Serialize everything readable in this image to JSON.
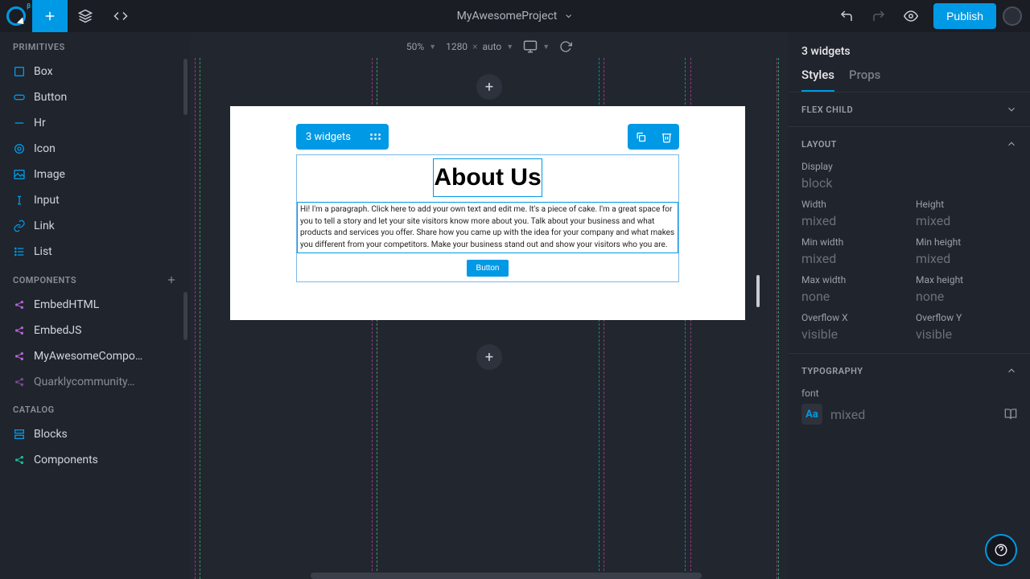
{
  "project": {
    "name": "MyAwesomeProject"
  },
  "topbar": {
    "publish": "Publish",
    "beta": "β"
  },
  "canvasToolbar": {
    "zoom": "50%",
    "width": "1280",
    "height": "auto",
    "sep": "×"
  },
  "selection": {
    "label": "3 widgets"
  },
  "artboard": {
    "heading": "About Us",
    "paragraph": "Hi! I'm a paragraph. Click here to add your own text and edit me. It's a piece of cake. I'm a great space for you to tell a story and let your site visitors know more about you. Talk about your business and what products and services you offer. Share how you came up with the idea for your company and what makes you different from your competitors. Make your business stand out and show your visitors who you are.",
    "button": "Button"
  },
  "left": {
    "sections": {
      "primitives": "PRIMITIVES",
      "components": "COMPONENTS",
      "catalog": "CATALOG"
    },
    "primitives": [
      "Box",
      "Button",
      "Hr",
      "Icon",
      "Image",
      "Input",
      "Link",
      "List"
    ],
    "components": [
      "EmbedHTML",
      "EmbedJS",
      "MyAwesomeCompo…",
      "Quarklycommunity…"
    ],
    "catalog": [
      "Blocks",
      "Components"
    ]
  },
  "right": {
    "title": "3 widgets",
    "tabs": {
      "styles": "Styles",
      "props": "Props"
    },
    "flexChild": "FLEX CHILD",
    "layout": {
      "title": "LAYOUT",
      "display": {
        "label": "Display",
        "value": "block"
      },
      "width": {
        "label": "Width",
        "value": "mixed"
      },
      "height": {
        "label": "Height",
        "value": "mixed"
      },
      "minWidth": {
        "label": "Min width",
        "value": "mixed"
      },
      "minHeight": {
        "label": "Min height",
        "value": "mixed"
      },
      "maxWidth": {
        "label": "Max width",
        "value": "none"
      },
      "maxHeight": {
        "label": "Max height",
        "value": "none"
      },
      "overflowX": {
        "label": "Overflow X",
        "value": "visible"
      },
      "overflowY": {
        "label": "Overflow Y",
        "value": "visible"
      }
    },
    "typography": {
      "title": "TYPOGRAPHY",
      "fontLabel": "font",
      "fontIcon": "Aa",
      "fontValue": "mixed"
    }
  }
}
